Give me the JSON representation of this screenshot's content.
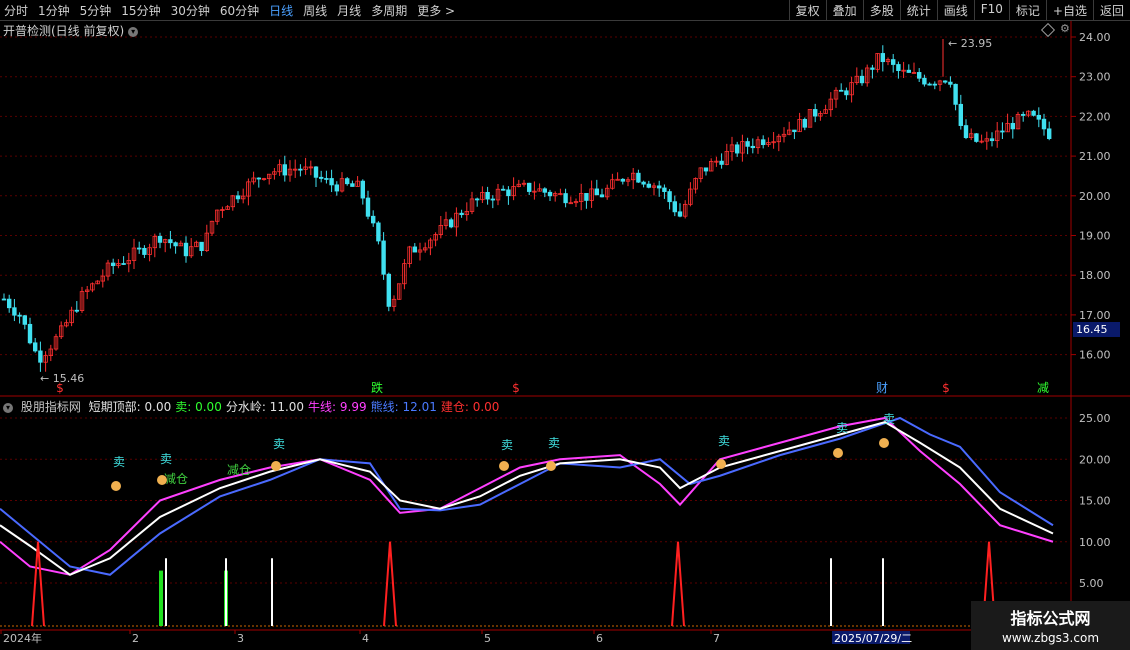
{
  "toolbar": {
    "periods": [
      "分时",
      "1分钟",
      "5分钟",
      "15分钟",
      "30分钟",
      "60分钟",
      "日线",
      "周线",
      "月线",
      "多周期",
      "更多 >"
    ],
    "active_period": "日线",
    "right_buttons": [
      "复权",
      "叠加",
      "多股",
      "统计",
      "画线",
      "F10",
      "标记",
      "+自选",
      "返回"
    ]
  },
  "main_chart": {
    "title": "开普检测(日线 前复权)",
    "y_ticks": [
      "24.00",
      "23.00",
      "22.00",
      "21.00",
      "20.00",
      "19.00",
      "18.00",
      "17.00",
      "16.00"
    ],
    "current_price": "16.45",
    "high_label": "23.95",
    "low_label": "15.46",
    "event_markers": [
      {
        "text": "$",
        "color": "#ff3030"
      },
      {
        "text": "跌",
        "color": "#30ff30"
      },
      {
        "text": "$",
        "color": "#ff3030"
      },
      {
        "text": "财",
        "color": "#4aa0ff"
      },
      {
        "text": "$",
        "color": "#ff3030"
      },
      {
        "text": "减",
        "color": "#30ff30"
      }
    ]
  },
  "indicator": {
    "name": "股朋指标网",
    "fields": [
      {
        "label": "短期顶部:",
        "value": "0.00",
        "color": "#e0e0e0"
      },
      {
        "label": "卖:",
        "value": "0.00",
        "color": "#30ff30"
      },
      {
        "label": "分水岭:",
        "value": "11.00",
        "color": "#e0e0e0"
      },
      {
        "label": "牛线:",
        "value": "9.99",
        "color": "#ff40ff"
      },
      {
        "label": "熊线:",
        "value": "12.01",
        "color": "#4a7aff"
      },
      {
        "label": "建仓:",
        "value": "0.00",
        "color": "#ff3030"
      }
    ],
    "y_ticks": [
      "25.00",
      "20.00",
      "15.00",
      "10.00",
      "5.00"
    ],
    "signals": [
      {
        "text": "卖",
        "color": "#40e0e0"
      },
      {
        "text": "卖",
        "color": "#40e0e0"
      },
      {
        "text": "减仓",
        "color": "#40d040"
      },
      {
        "text": "减仓",
        "color": "#40d040"
      },
      {
        "text": "卖",
        "color": "#40e0e0"
      },
      {
        "text": "卖",
        "color": "#40e0e0"
      },
      {
        "text": "卖",
        "color": "#40e0e0"
      },
      {
        "text": "卖",
        "color": "#40e0e0"
      },
      {
        "text": "卖",
        "color": "#40e0e0"
      },
      {
        "text": "卖",
        "color": "#40e0e0"
      }
    ]
  },
  "x_axis": {
    "labels": [
      "2024年",
      "2",
      "3",
      "4",
      "5",
      "6",
      "7"
    ],
    "highlight_date": "2025/07/29/二"
  },
  "watermark": {
    "line1": "指标公式网",
    "line2": "www.zbgs3.com"
  },
  "colors": {
    "up": "#ff3030",
    "down": "#40e0f0",
    "grid": "#5a0000",
    "axis": "#a00000"
  }
}
